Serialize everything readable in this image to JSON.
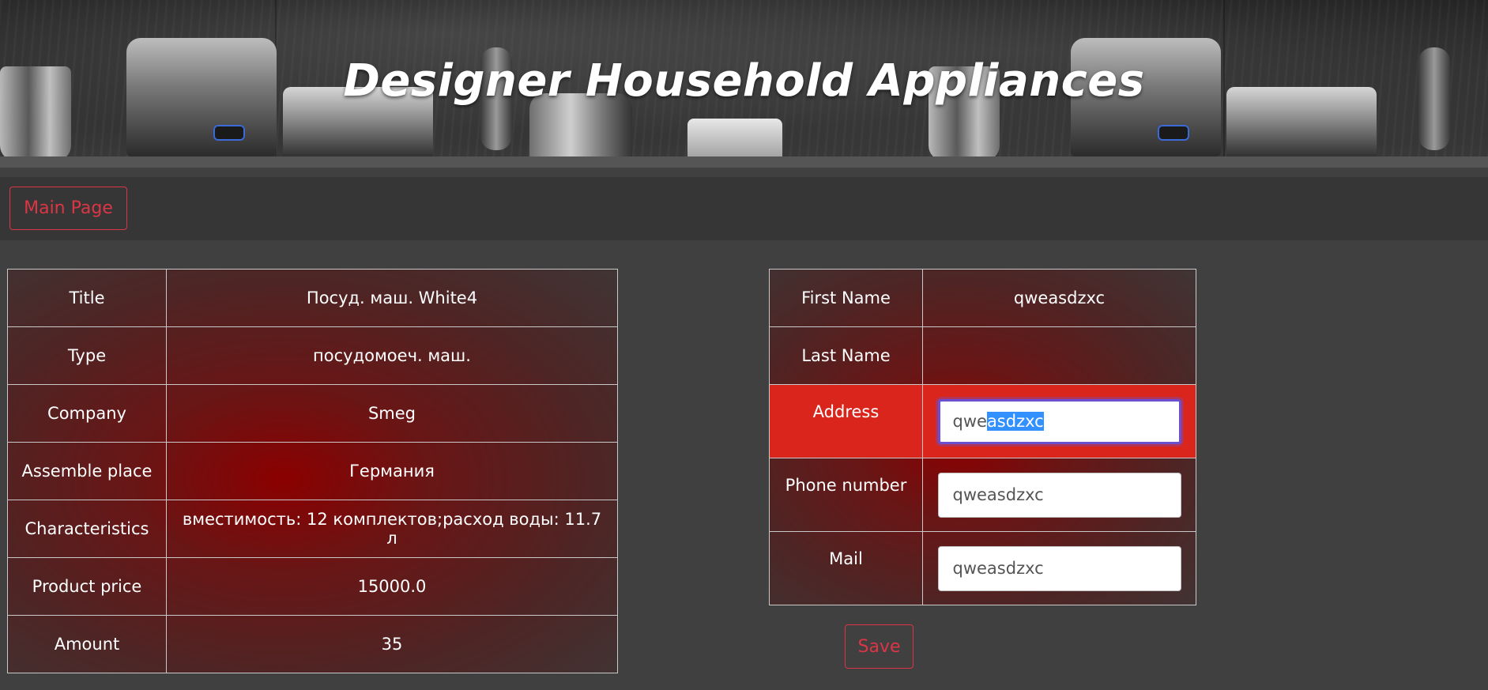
{
  "header": {
    "title": "Designer Household Appliances"
  },
  "nav": {
    "main_page_label": "Main Page"
  },
  "product": {
    "rows": [
      {
        "label": "Title",
        "value": "Посуд. маш. White4"
      },
      {
        "label": "Type",
        "value": "посудомоеч. маш."
      },
      {
        "label": "Company",
        "value": "Smeg"
      },
      {
        "label": "Assemble place",
        "value": "Германия"
      },
      {
        "label": "Characteristics",
        "value": "вместимость: 12 комплектов;расход воды: 11.7 л"
      },
      {
        "label": "Product price",
        "value": "15000.0"
      },
      {
        "label": "Amount",
        "value": "35"
      }
    ]
  },
  "customer": {
    "first_name_label": "First Name",
    "first_name_value": "qweasdzxc",
    "last_name_label": "Last Name",
    "last_name_value": "",
    "address_label": "Address",
    "address_value_unselected": "qwe",
    "address_value_selected": "asdzxc",
    "phone_label": "Phone number",
    "phone_value": "qweasdzxc",
    "mail_label": "Mail",
    "mail_value": "qweasdzxc",
    "highlight_color": "#d9251c"
  },
  "actions": {
    "save_label": "Save"
  },
  "colors": {
    "accent": "#dc3545",
    "page_background": "#404040",
    "selection": "#3390ff"
  }
}
